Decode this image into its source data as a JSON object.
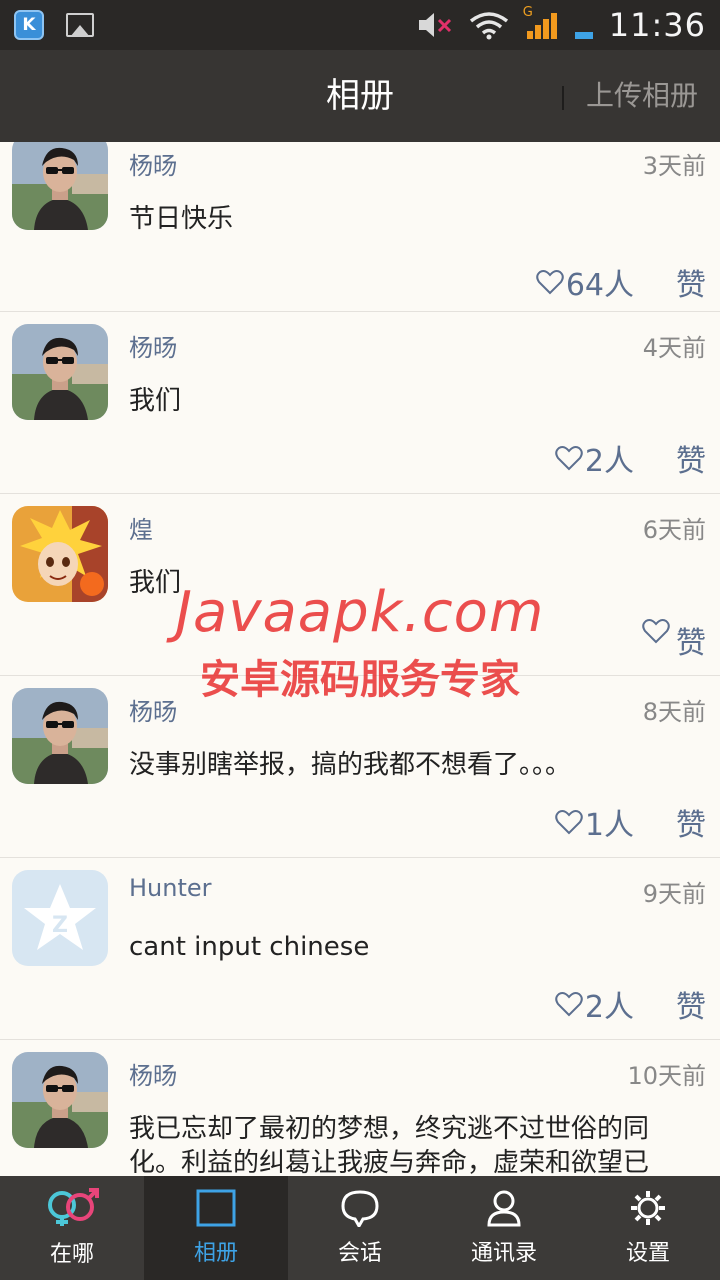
{
  "status_bar": {
    "time": "11:36",
    "network_label": "G"
  },
  "header": {
    "title": "相册",
    "action": "上传相册"
  },
  "posts": [
    {
      "name": "杨旸",
      "time": "3天前",
      "text": "节日快乐",
      "likes": "64人",
      "like_label": "赞"
    },
    {
      "name": "杨旸",
      "time": "4天前",
      "text": "我们",
      "likes": "2人",
      "like_label": "赞"
    },
    {
      "name": "煌",
      "time": "6天前",
      "text": "我们",
      "likes": "",
      "like_label": "赞"
    },
    {
      "name": "杨旸",
      "time": "8天前",
      "text": "没事别瞎举报，搞的我都不想看了。。。",
      "likes": "1人",
      "like_label": "赞"
    },
    {
      "name": "Hunter",
      "time": "9天前",
      "text": "cant input chinese",
      "likes": "2人",
      "like_label": "赞"
    },
    {
      "name": "杨旸",
      "time": "10天前",
      "text": "我已忘却了最初的梦想，终究逃不过世俗的同化。利益的纠葛让我疲与奔命，虚荣和欲望已",
      "likes": "",
      "like_label": ""
    }
  ],
  "watermark": {
    "line1": "Javaapk.com",
    "line2": "安卓源码服务专家"
  },
  "nav": [
    {
      "label": "在哪",
      "icon": "gender-icon"
    },
    {
      "label": "相册",
      "icon": "album-icon"
    },
    {
      "label": "会话",
      "icon": "chat-bubble-icon"
    },
    {
      "label": "通讯录",
      "icon": "contacts-icon"
    },
    {
      "label": "设置",
      "icon": "gear-icon"
    }
  ],
  "colors": {
    "accent": "#3ea3e6",
    "name_link": "#5c6f8f",
    "header_bg": "#373533",
    "nav_bg": "#3c3a38",
    "watermark": "#e62828"
  }
}
